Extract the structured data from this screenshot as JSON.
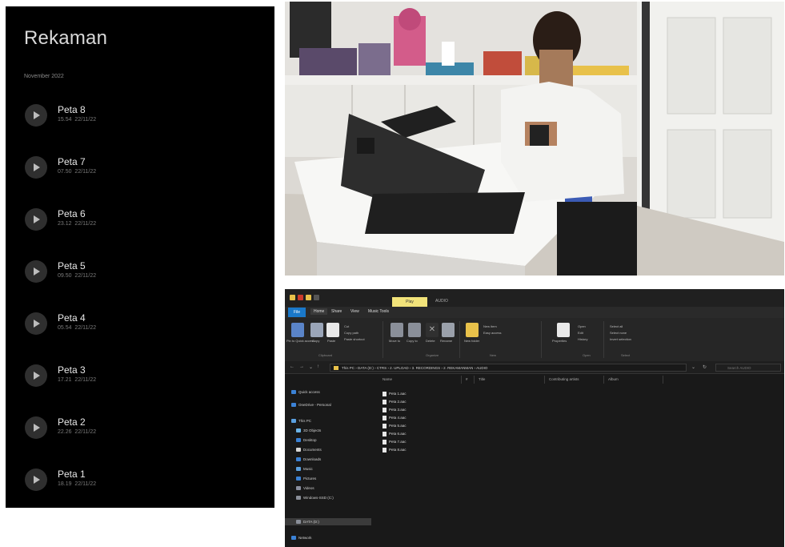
{
  "recordings": {
    "title": "Rekaman",
    "month": "November 2022",
    "items": [
      {
        "name": "Peta 8",
        "time": "15.54",
        "date": "22/11/22"
      },
      {
        "name": "Peta 7",
        "time": "07.50",
        "date": "22/11/22"
      },
      {
        "name": "Peta 6",
        "time": "23.12",
        "date": "22/11/22"
      },
      {
        "name": "Peta 5",
        "time": "09.50",
        "date": "22/11/22"
      },
      {
        "name": "Peta 4",
        "time": "05.54",
        "date": "22/11/22"
      },
      {
        "name": "Peta 3",
        "time": "17.21",
        "date": "22/11/22"
      },
      {
        "name": "Peta 2",
        "time": "22.26",
        "date": "22/11/22"
      },
      {
        "name": "Peta 1",
        "time": "18.19",
        "date": "22/11/22"
      }
    ]
  },
  "explorer": {
    "manage_tab": "Play",
    "window_title": "AUDIO",
    "tabs": {
      "file": "File",
      "home": "Home",
      "share": "Share",
      "view": "View",
      "tools": "Music Tools"
    },
    "ribbon": {
      "pin": "Pin to Quick access",
      "copy": "Copy",
      "paste": "Paste",
      "cut": "Cut",
      "copy_path": "Copy path",
      "paste_shortcut": "Paste shortcut",
      "move_to": "Move to",
      "copy_to": "Copy to",
      "delete": "Delete",
      "rename": "Rename",
      "new_folder": "New folder",
      "new_item": "New item",
      "easy_access": "Easy access",
      "properties": "Properties",
      "open": "Open",
      "edit": "Edit",
      "history": "History",
      "select_all": "Select all",
      "select_none": "Select none",
      "invert_selection": "Invert selection",
      "group_clipboard": "Clipboard",
      "group_organize": "Organize",
      "group_new": "New",
      "group_open": "Open",
      "group_select": "Select"
    },
    "path": "This PC  ›  DATA (D:)  ›  CTRS  ›  2. UPLOAD  ›  3. RECORDINGS  ›  2. REKAMANMAN  ›  AUDIO",
    "search_placeholder": "Search AUDIO",
    "nav": [
      "Quick access",
      "OneDrive - Personal",
      "This PC",
      "3D Objects",
      "Desktop",
      "Documents",
      "Downloads",
      "Music",
      "Pictures",
      "Videos",
      "Windows-SSD (C:)",
      "DATA (D:)",
      "Network"
    ],
    "columns": {
      "name": "Name",
      "num": "#",
      "title": "Title",
      "artists": "Contributing artists",
      "album": "Album"
    },
    "files": [
      "Peta 1.aac",
      "Peta 2.aac",
      "Peta 3.aac",
      "Peta 4.aac",
      "Peta 5.aac",
      "Peta 6.aac",
      "Peta 7.aac",
      "Peta 8.aac"
    ]
  },
  "colors": {
    "manage_tab": "#f2e37a",
    "file_tab": "#1a78c9",
    "folder": "#e8c14a"
  }
}
